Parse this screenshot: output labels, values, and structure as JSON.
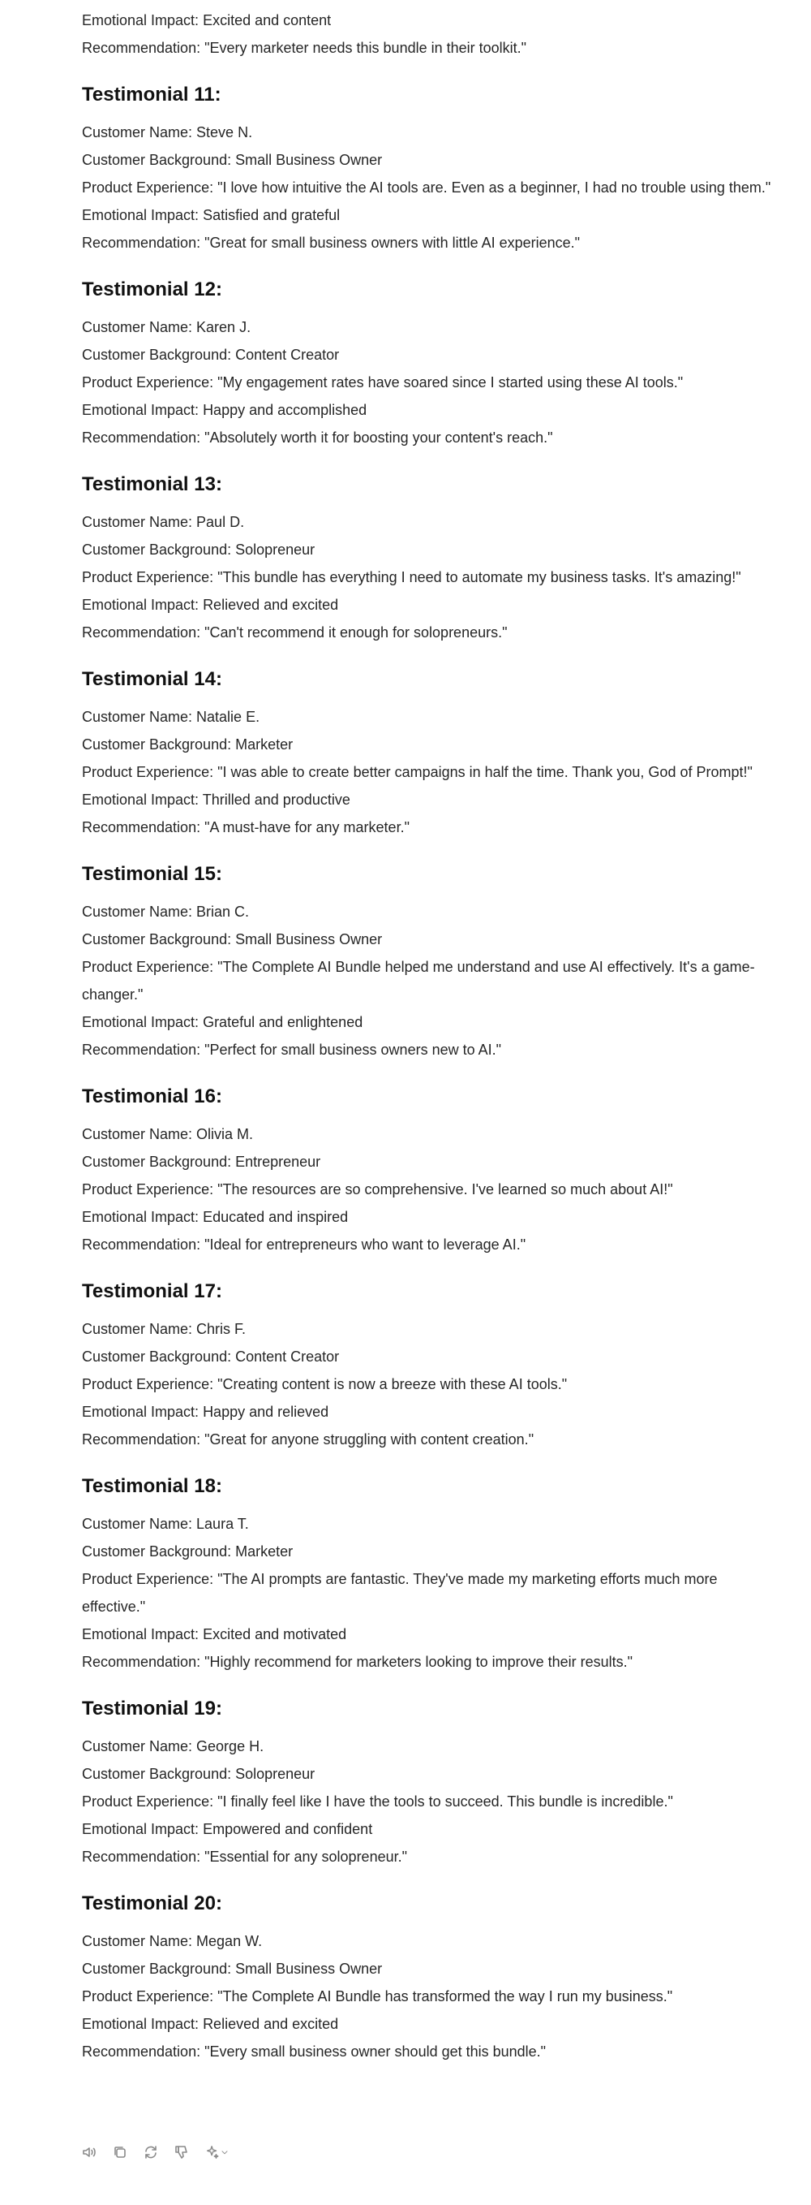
{
  "previous": {
    "emotional_impact": "Emotional Impact: Excited and content",
    "recommendation": "Recommendation: \"Every marketer needs this bundle in their toolkit.\""
  },
  "testimonials": [
    {
      "title": "Testimonial 11:",
      "name": "Customer Name: Steve N.",
      "background": "Customer Background: Small Business Owner",
      "experience": "Product Experience: \"I love how intuitive the AI tools are. Even as a beginner, I had no trouble using them.\"",
      "impact": "Emotional Impact: Satisfied and grateful",
      "recommendation": "Recommendation: \"Great for small business owners with little AI experience.\""
    },
    {
      "title": "Testimonial 12:",
      "name": "Customer Name: Karen J.",
      "background": "Customer Background: Content Creator",
      "experience": "Product Experience: \"My engagement rates have soared since I started using these AI tools.\"",
      "impact": "Emotional Impact: Happy and accomplished",
      "recommendation": "Recommendation: \"Absolutely worth it for boosting your content's reach.\""
    },
    {
      "title": "Testimonial 13:",
      "name": "Customer Name: Paul D.",
      "background": "Customer Background: Solopreneur",
      "experience": "Product Experience: \"This bundle has everything I need to automate my business tasks. It's amazing!\"",
      "impact": "Emotional Impact: Relieved and excited",
      "recommendation": "Recommendation: \"Can't recommend it enough for solopreneurs.\""
    },
    {
      "title": "Testimonial 14:",
      "name": "Customer Name: Natalie E.",
      "background": "Customer Background: Marketer",
      "experience": "Product Experience: \"I was able to create better campaigns in half the time. Thank you, God of Prompt!\"",
      "impact": "Emotional Impact: Thrilled and productive",
      "recommendation": "Recommendation: \"A must-have for any marketer.\""
    },
    {
      "title": "Testimonial 15:",
      "name": "Customer Name: Brian C.",
      "background": "Customer Background: Small Business Owner",
      "experience": "Product Experience: \"The Complete AI Bundle helped me understand and use AI effectively. It's a game-changer.\"",
      "impact": "Emotional Impact: Grateful and enlightened",
      "recommendation": "Recommendation: \"Perfect for small business owners new to AI.\""
    },
    {
      "title": "Testimonial 16:",
      "name": "Customer Name: Olivia M.",
      "background": "Customer Background: Entrepreneur",
      "experience": "Product Experience: \"The resources are so comprehensive. I've learned so much about AI!\"",
      "impact": "Emotional Impact: Educated and inspired",
      "recommendation": "Recommendation: \"Ideal for entrepreneurs who want to leverage AI.\""
    },
    {
      "title": "Testimonial 17:",
      "name": "Customer Name: Chris F.",
      "background": "Customer Background: Content Creator",
      "experience": "Product Experience: \"Creating content is now a breeze with these AI tools.\"",
      "impact": "Emotional Impact: Happy and relieved",
      "recommendation": "Recommendation: \"Great for anyone struggling with content creation.\""
    },
    {
      "title": "Testimonial 18:",
      "name": "Customer Name: Laura T.",
      "background": "Customer Background: Marketer",
      "experience": "Product Experience: \"The AI prompts are fantastic. They've made my marketing efforts much more effective.\"",
      "impact": "Emotional Impact: Excited and motivated",
      "recommendation": "Recommendation: \"Highly recommend for marketers looking to improve their results.\""
    },
    {
      "title": "Testimonial 19:",
      "name": "Customer Name: George H.",
      "background": "Customer Background: Solopreneur",
      "experience": "Product Experience: \"I finally feel like I have the tools to succeed. This bundle is incredible.\"",
      "impact": "Emotional Impact: Empowered and confident",
      "recommendation": "Recommendation: \"Essential for any solopreneur.\""
    },
    {
      "title": "Testimonial 20:",
      "name": "Customer Name: Megan W.",
      "background": "Customer Background: Small Business Owner",
      "experience": "Product Experience: \"The Complete AI Bundle has transformed the way I run my business.\"",
      "impact": "Emotional Impact: Relieved and excited",
      "recommendation": "Recommendation: \"Every small business owner should get this bundle.\""
    }
  ],
  "actions": [
    {
      "name": "read-aloud-icon"
    },
    {
      "name": "copy-icon"
    },
    {
      "name": "regenerate-icon"
    },
    {
      "name": "thumbs-down-icon"
    },
    {
      "name": "sparkle-model-icon"
    }
  ]
}
